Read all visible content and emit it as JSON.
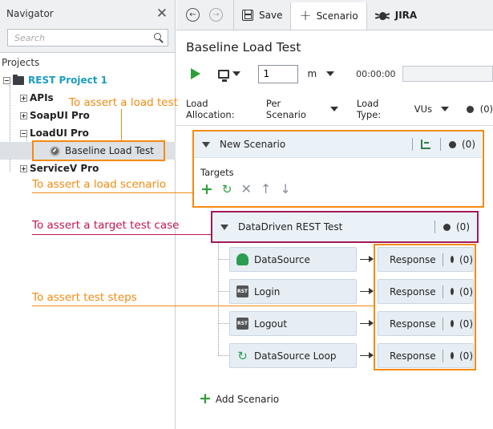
{
  "navigator": {
    "title": "Navigator",
    "search_placeholder": "Search",
    "projects_label": "Projects",
    "project": "REST Project 1",
    "items": [
      "APIs",
      "SoapUI Pro",
      "LoadUI Pro",
      "ServiceV Pro"
    ],
    "selected_test": "Baseline Load Test"
  },
  "toolbar": {
    "save": "Save",
    "scenario": "Scenario",
    "jira": "JIRA"
  },
  "main": {
    "title": "Baseline Load Test",
    "run_value": "1",
    "unit": "m",
    "time": "00:00:00",
    "alloc_label": "Load Allocation:",
    "alloc_value": "Per Scenario",
    "loadtype_label": "Load Type:",
    "loadtype_value": "VUs",
    "count": "(0)"
  },
  "scenario": {
    "name": "New Scenario",
    "count": "(0)",
    "targets_label": "Targets"
  },
  "testcase": {
    "name": "DataDriven REST Test",
    "count": "(0)"
  },
  "steps": [
    {
      "name": "DataSource",
      "response": "Response",
      "count": "(0)"
    },
    {
      "name": "Login",
      "response": "Response",
      "count": "(0)"
    },
    {
      "name": "Logout",
      "response": "Response",
      "count": "(0)"
    },
    {
      "name": "DataSource Loop",
      "response": "Response",
      "count": "(0)"
    }
  ],
  "add_scenario": "Add Scenario",
  "annotations": {
    "load_test": "To assert a load test",
    "load_scenario": "To assert a load scenario",
    "target_case": "To assert a target test case",
    "test_steps": "To assert test steps"
  },
  "colors": {
    "annotation_orange": "#f48a10",
    "annotation_crimson": "#c0174c",
    "project_blue": "#1b9dc0",
    "run_green": "#2f9e3a"
  }
}
